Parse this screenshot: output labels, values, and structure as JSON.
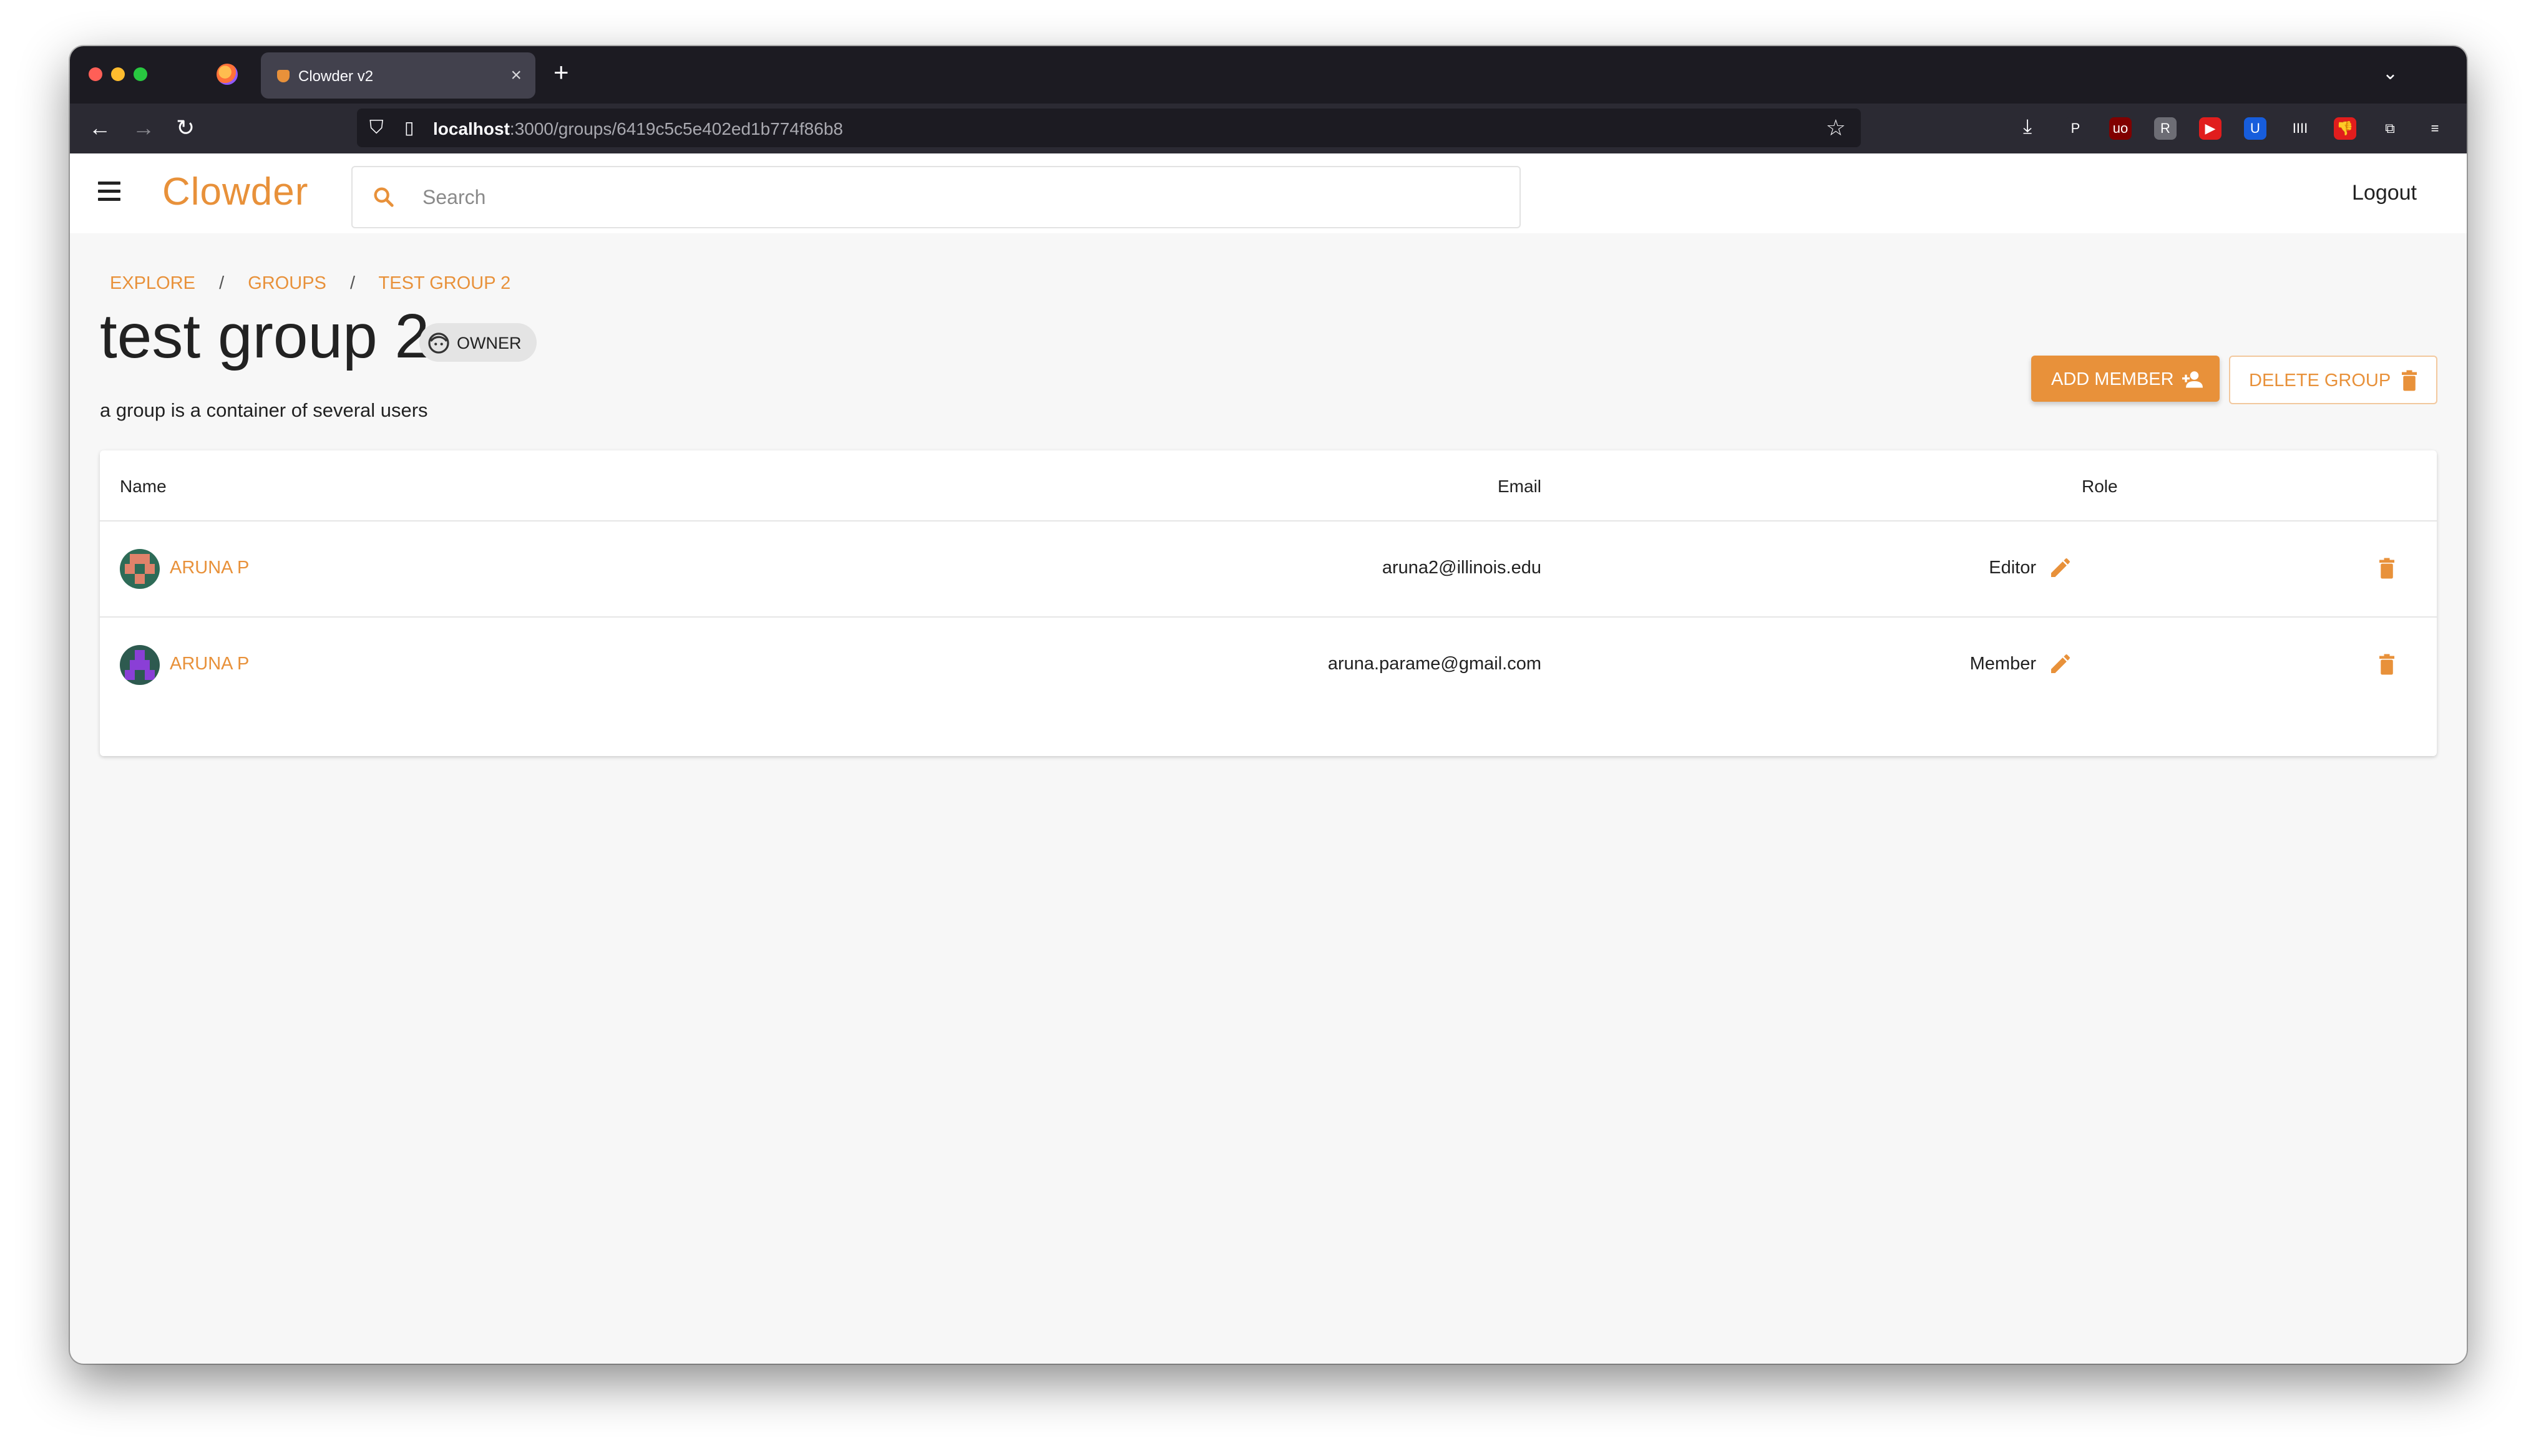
{
  "browser": {
    "tab_title": "Clowder v2",
    "url_host": "localhost",
    "url_path": ":3000/groups/6419c5c5e402ed1b774f86b8",
    "extensions": [
      {
        "name": "pocket-icon",
        "color": "#2b2a33",
        "glyph": "P"
      },
      {
        "name": "ublock-icon",
        "color": "#800000",
        "glyph": "uo"
      },
      {
        "name": "reader-icon",
        "color": "#6d6d75",
        "glyph": "R"
      },
      {
        "name": "youtube-icon",
        "color": "#e11d1d",
        "glyph": "▶"
      },
      {
        "name": "bitwarden-icon",
        "color": "#175ddc",
        "glyph": "U"
      },
      {
        "name": "library-icon",
        "color": "#2b2a33",
        "glyph": "IIII"
      },
      {
        "name": "dislike-icon",
        "color": "#e11d1d",
        "glyph": "👎"
      },
      {
        "name": "puzzle-icon",
        "color": "#2b2a33",
        "glyph": "⧉"
      },
      {
        "name": "menu-icon",
        "color": "#2b2a33",
        "glyph": "≡"
      }
    ]
  },
  "app": {
    "logo": "Clowder",
    "search_placeholder": "Search",
    "logout_label": "Logout"
  },
  "breadcrumbs": {
    "explore": "EXPLORE",
    "groups": "GROUPS",
    "current": "TEST GROUP 2",
    "separator": "/"
  },
  "group": {
    "title": "test group 2",
    "role_chip": "OWNER",
    "description": "a group is a container of several users",
    "add_member_label": "ADD MEMBER",
    "delete_group_label": "DELETE GROUP"
  },
  "table": {
    "headers": {
      "name": "Name",
      "email": "Email",
      "role": "Role"
    },
    "rows": [
      {
        "name": "ARUNA P",
        "email": "aruna2@illinois.edu",
        "role": "Editor",
        "avatar_color": "#2e6b57",
        "avatar_accent": "#e0826a"
      },
      {
        "name": "ARUNA P",
        "email": "aruna.parame@gmail.com",
        "role": "Member",
        "avatar_color": "#2d5a4f",
        "avatar_accent": "#8a3fd6"
      }
    ]
  },
  "colors": {
    "accent": "#e8913a",
    "text": "#222222",
    "background": "#f7f7f7"
  }
}
